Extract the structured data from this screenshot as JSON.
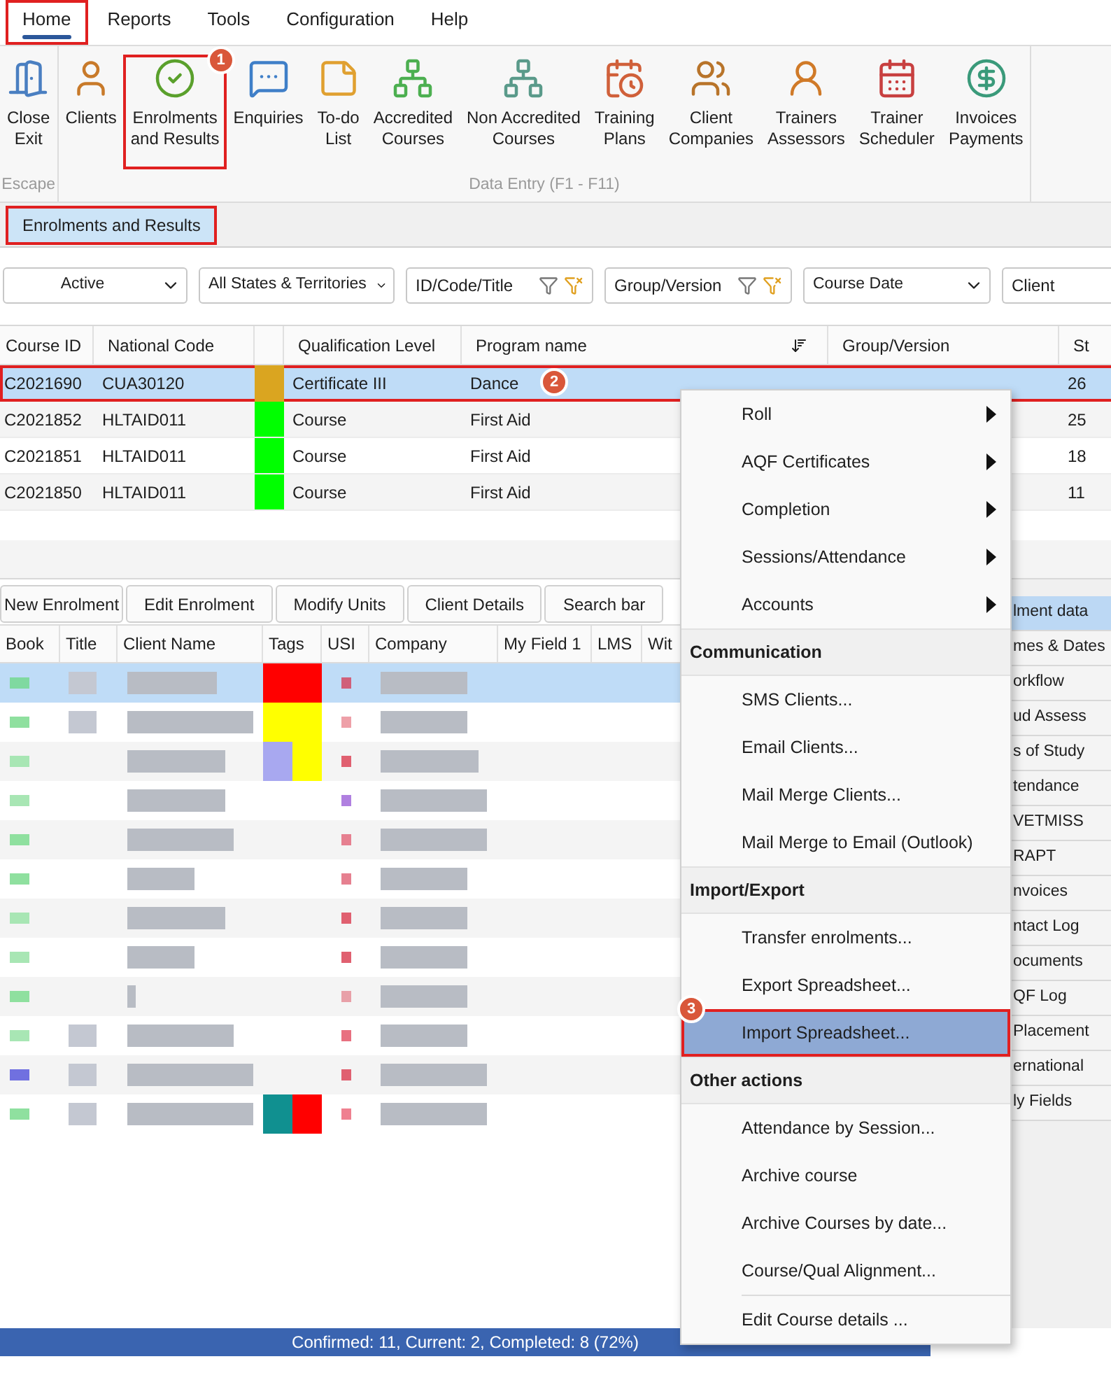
{
  "menu_bar": {
    "tabs": [
      {
        "label": "Home",
        "selected": true,
        "highlighted": true
      },
      {
        "label": "Reports",
        "selected": false,
        "highlighted": false
      },
      {
        "label": "Tools",
        "selected": false,
        "highlighted": false
      },
      {
        "label": "Configuration",
        "selected": false,
        "highlighted": false
      },
      {
        "label": "Help",
        "selected": false,
        "highlighted": false
      }
    ]
  },
  "ribbon": {
    "groups": [
      {
        "title": "Escape",
        "buttons": [
          {
            "label": "Close\nExit",
            "highlighted": false
          }
        ]
      },
      {
        "title": "Data Entry (F1 - F11)",
        "buttons": [
          {
            "label": "Clients",
            "highlighted": false
          },
          {
            "label": "Enrolments\nand Results",
            "highlighted": true,
            "badge": "1"
          },
          {
            "label": "Enquiries",
            "highlighted": false
          },
          {
            "label": "To-do\nList",
            "highlighted": false
          },
          {
            "label": "Accredited\nCourses",
            "highlighted": false
          },
          {
            "label": "Non Accredited\nCourses",
            "highlighted": false
          },
          {
            "label": "Training\nPlans",
            "highlighted": false
          },
          {
            "label": "Client\nCompanies",
            "highlighted": false
          },
          {
            "label": "Trainers\nAssessors",
            "highlighted": false
          },
          {
            "label": "Trainer\nScheduler",
            "highlighted": false
          },
          {
            "label": "Invoices\nPayments",
            "highlighted": false
          }
        ]
      }
    ]
  },
  "document_tabs": [
    {
      "label": "Enrolments and Results",
      "selected": true,
      "highlighted": true
    }
  ],
  "filters": [
    {
      "kind": "dropdown",
      "value": "Active"
    },
    {
      "kind": "dropdown",
      "value": "All States & Territories"
    },
    {
      "kind": "filter",
      "placeholder": "ID/Code/Title"
    },
    {
      "kind": "filter",
      "placeholder": "Group/Version"
    },
    {
      "kind": "dropdown",
      "value": "Course Date"
    },
    {
      "kind": "field",
      "placeholder": "Client"
    }
  ],
  "course_grid": {
    "columns": [
      {
        "kind": "text",
        "label": "Course ID"
      },
      {
        "kind": "text",
        "label": "National Code"
      },
      {
        "kind": "color"
      },
      {
        "kind": "text",
        "label": "Qualification Level"
      },
      {
        "kind": "sorted",
        "label": "Program name"
      },
      {
        "kind": "text",
        "label": "Group/Version"
      },
      {
        "kind": "text",
        "label": "St"
      }
    ],
    "rows": [
      {
        "course_id": "C2021690",
        "national_code": "CUA30120",
        "color": "#daa520",
        "qualification_level": "Certificate III",
        "program_name": "Dance",
        "column_7": "26",
        "selected": true,
        "highlighted": true,
        "badge": "2"
      },
      {
        "course_id": "C2021852",
        "national_code": "HLTAID011",
        "color": "#00ff00",
        "qualification_level": "Course",
        "program_name": "First Aid",
        "column_7": "25",
        "selected": false,
        "highlighted": false
      },
      {
        "course_id": "C2021851",
        "national_code": "HLTAID011",
        "color": "#00ff00",
        "qualification_level": "Course",
        "program_name": "First Aid",
        "column_7": "18",
        "selected": false,
        "highlighted": false
      },
      {
        "course_id": "C2021850",
        "national_code": "HLTAID011",
        "color": "#00ff00",
        "qualification_level": "Course",
        "program_name": "First Aid",
        "column_7": "11",
        "selected": false,
        "highlighted": false
      }
    ]
  },
  "enrolment_toolbar": [
    "New Enrolment",
    "Edit Enrolment",
    "Modify Units",
    "Client Details",
    "Search bar"
  ],
  "enrolment_grid": {
    "columns": [
      "Book",
      "Title",
      "Client Name",
      "Tags",
      "USI",
      "Company",
      "My Field 1",
      "LMS",
      "Wit"
    ],
    "rows": [
      {
        "selected": true,
        "book": {
          "color": "#7fd9a0"
        },
        "tags": [
          {
            "color": "#ff0000"
          }
        ],
        "usi": {
          "color": "#d0607a"
        }
      },
      {
        "selected": false,
        "book": {
          "color": "#8fe09f"
        },
        "tags": [
          {
            "color": "#ffff00"
          }
        ],
        "usi": {
          "color": "#eea0a8"
        }
      },
      {
        "selected": false,
        "book": {
          "color": "#a8e6b4"
        },
        "tags": [
          {
            "color": "#a8a8f0"
          },
          {
            "color": "#ffff00"
          }
        ],
        "usi": {
          "color": "#e06070"
        }
      },
      {
        "selected": false,
        "book": {
          "color": "#a8e6b4"
        },
        "tags": [],
        "usi": {
          "color": "#b080e0"
        }
      },
      {
        "selected": false,
        "book": {
          "color": "#8fe09f"
        },
        "tags": [],
        "usi": {
          "color": "#e68090"
        }
      },
      {
        "selected": false,
        "book": {
          "color": "#8fe09f"
        },
        "tags": [],
        "usi": {
          "color": "#e68090"
        }
      },
      {
        "selected": false,
        "book": {
          "color": "#a8e6b4"
        },
        "tags": [],
        "usi": {
          "color": "#e06070"
        }
      },
      {
        "selected": false,
        "book": {
          "color": "#a8e6b4"
        },
        "tags": [],
        "usi": {
          "color": "#e06070"
        }
      },
      {
        "selected": false,
        "book": {
          "color": "#8fe09f"
        },
        "tags": [],
        "usi": {
          "color": "#e8a0a8"
        }
      },
      {
        "selected": false,
        "book": {
          "color": "#a8e6b4"
        },
        "tags": [],
        "usi": {
          "color": "#e87080"
        }
      },
      {
        "selected": false,
        "book": {
          "color": "#7070e0"
        },
        "tags": [],
        "usi": {
          "color": "#e06070"
        }
      },
      {
        "selected": false,
        "book": {
          "color": "#8fe09f"
        },
        "tags": [
          {
            "color": "#109090"
          },
          {
            "color": "#ff0000"
          }
        ],
        "usi": {
          "color": "#ef8090"
        }
      }
    ]
  },
  "side_tabs": [
    {
      "label": "lment data",
      "selected": true
    },
    {
      "label": "mes & Dates",
      "selected": false
    },
    {
      "label": "orkflow",
      "selected": false
    },
    {
      "label": "ud Assess",
      "selected": false
    },
    {
      "label": "s of Study",
      "selected": false
    },
    {
      "label": "tendance",
      "selected": false
    },
    {
      "label": "VETMISS",
      "selected": false
    },
    {
      "label": "RAPT",
      "selected": false
    },
    {
      "label": "nvoices",
      "selected": false
    },
    {
      "label": "ntact Log",
      "selected": false
    },
    {
      "label": "ocuments",
      "selected": false
    },
    {
      "label": "QF Log",
      "selected": false
    },
    {
      "label": "Placement",
      "selected": false
    },
    {
      "label": "ernational",
      "selected": false
    },
    {
      "label": "ly Fields",
      "selected": false
    }
  ],
  "context_menu": {
    "items": [
      {
        "kind": "submenu",
        "label": "Roll",
        "selected": false
      },
      {
        "kind": "submenu",
        "label": "AQF Certificates",
        "selected": false
      },
      {
        "kind": "submenu",
        "label": "Completion",
        "selected": false
      },
      {
        "kind": "submenu",
        "label": "Sessions/Attendance",
        "selected": false
      },
      {
        "kind": "submenu",
        "label": "Accounts",
        "selected": false
      },
      {
        "kind": "header",
        "label": "Communication"
      },
      {
        "kind": "item",
        "label": "SMS Clients...",
        "selected": false
      },
      {
        "kind": "item",
        "label": "Email Clients...",
        "selected": false
      },
      {
        "kind": "item",
        "label": "Mail Merge Clients...",
        "selected": false
      },
      {
        "kind": "item",
        "label": "Mail Merge to Email (Outlook)",
        "selected": false
      },
      {
        "kind": "header",
        "label": "Import/Export"
      },
      {
        "kind": "item",
        "label": "Transfer enrolments...",
        "selected": false
      },
      {
        "kind": "item",
        "label": "Export Spreadsheet...",
        "selected": false
      },
      {
        "kind": "item",
        "label": "Import Spreadsheet...",
        "selected": true,
        "badge": "3"
      },
      {
        "kind": "header",
        "label": "Other actions"
      },
      {
        "kind": "item",
        "label": "Attendance by Session...",
        "selected": false
      },
      {
        "kind": "item",
        "label": "Archive course",
        "selected": false
      },
      {
        "kind": "item",
        "label": "Archive Courses by date...",
        "selected": false
      },
      {
        "kind": "item",
        "label": "Course/Qual Alignment...",
        "selected": false
      },
      {
        "kind": "separator"
      },
      {
        "kind": "item",
        "label": "Edit Course details ...",
        "selected": false
      }
    ]
  },
  "status_bar": {
    "text": "Confirmed: 11, Current: 2, Completed: 8 (72%)"
  }
}
